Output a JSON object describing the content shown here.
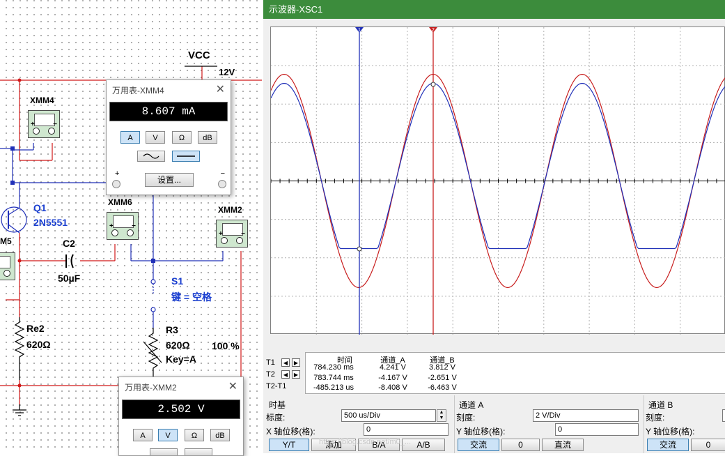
{
  "schematic": {
    "labels": {
      "vcc": "VCC",
      "vcc_value": "12V",
      "xmm4": "XMM4",
      "xmm6": "XMM6",
      "xmm2": "XMM2",
      "xmm5_partial": "M5",
      "q1_name": "Q1",
      "q1_part": "2N5551",
      "c2_name": "C2",
      "c2_value": "50µF",
      "s1_name": "S1",
      "s1_key": "键 = 空格",
      "re2_name": "Re2",
      "re2_value": "620Ω",
      "r3_name": "R3",
      "r3_value": "620Ω",
      "r3_key": "Key=A",
      "r3_percent": "100 %",
      "plus": "+",
      "minus": "−"
    }
  },
  "multimeter_xmm4": {
    "title": "万用表-XMM4",
    "close": "✕",
    "display": "8.607 mA",
    "buttons": [
      "A",
      "V",
      "Ω",
      "dB"
    ],
    "active_button": "A",
    "plus": "+",
    "minus": "−",
    "settings_label": "设置..."
  },
  "multimeter_xmm2": {
    "title": "万用表-XMM2",
    "close": "✕",
    "display": "2.502 V",
    "buttons": [
      "A",
      "V",
      "Ω",
      "dB"
    ],
    "active_button": "V"
  },
  "oscilloscope": {
    "title": "示波器-XSC1",
    "cursor_labels": {
      "t1": "1",
      "t2": "2"
    },
    "colors": {
      "channel_a": "#c81e1e",
      "channel_b": "#2030b8",
      "cursor_t1": "#2030b8",
      "cursor_t2": "#c81e1e",
      "title_bar": "#3c8c3c"
    },
    "readout": {
      "headers": [
        "时间",
        "通道_A",
        "通道_B"
      ],
      "rows": [
        {
          "label": "T1",
          "time": "784.230 ms",
          "a": "4.241 V",
          "b": "3.812 V"
        },
        {
          "label": "T2",
          "time": "783.744 ms",
          "a": "-4.167 V",
          "b": "-2.651 V"
        },
        {
          "label": "T2-T1",
          "time": "-485.213 us",
          "a": "-8.408 V",
          "b": "-6.463 V"
        }
      ]
    },
    "timebase": {
      "section_label": "时基",
      "scale_label": "标度:",
      "scale_value": "500 us/Div",
      "xpos_label": "X 轴位移(格):",
      "xpos_value": "0",
      "buttons": [
        "Y/T",
        "添加",
        "B/A",
        "A/B"
      ],
      "active_button": "Y/T"
    },
    "channel_a": {
      "section_label": "通道 A",
      "scale_label": "刻度:",
      "scale_value": "2  V/Div",
      "ypos_label": "Y 轴位移(格):",
      "ypos_value": "0",
      "buttons": [
        "交流",
        "0",
        "直流"
      ],
      "active_button": "交流"
    },
    "channel_b": {
      "section_label": "通道 B",
      "scale_label": "刻度:",
      "ypos_label": "Y 轴位移(格):",
      "buttons": [
        "交流",
        "0"
      ],
      "active_button": "交流"
    },
    "watermark": "https://blog.csdn.net/m0_..."
  }
}
